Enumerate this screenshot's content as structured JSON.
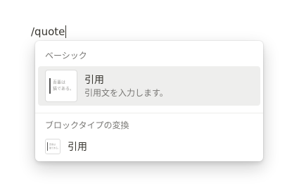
{
  "editor": {
    "typed_text": "/quote"
  },
  "menu": {
    "basic_section": {
      "header": "ベーシック",
      "items": [
        {
          "icon": "quote-block-thumbnail",
          "thumb_lines": [
            "吾輩は",
            "猫である。"
          ],
          "title": "引用",
          "description": "引用文を入力します。"
        }
      ]
    },
    "turn_into_section": {
      "header": "ブロックタイプの変換",
      "items": [
        {
          "icon": "quote-block-thumbnail",
          "thumb_lines": [
            "吾輩は",
            "猫である。"
          ],
          "title": "引用"
        }
      ]
    }
  },
  "colors": {
    "hover_background": "#eeeeed",
    "text_primary": "#37352f",
    "text_secondary": "#787774"
  }
}
